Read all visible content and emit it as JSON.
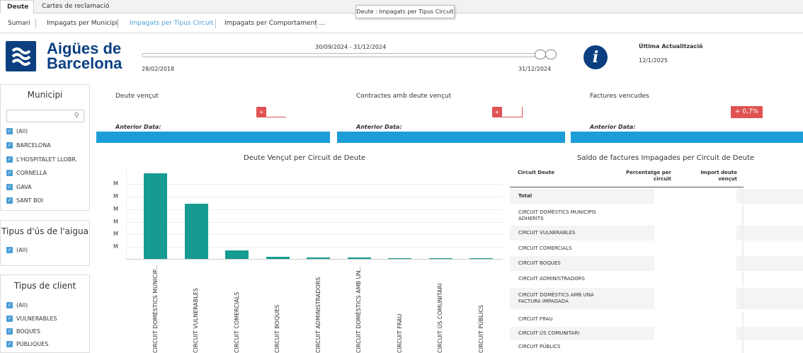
{
  "tabs": [
    "Deute",
    "Cartes de reclamació"
  ],
  "tooltip": "Deute : Impagats per Tipus Circuit",
  "subnav": [
    "Sumari",
    "Impagats per Municipi",
    "Impagats per Tipus Circuit",
    "Impagats per Comportament ..."
  ],
  "logo": {
    "line1": "Aigües de",
    "line2": "Barcelona"
  },
  "date_range": {
    "label": "30/09/2024 - 31/12/2024",
    "min": "28/02/2018",
    "max": "31/12/2024"
  },
  "last_update": {
    "title": "Última Actualització",
    "value": "12/1/2025"
  },
  "filters": {
    "municipi": {
      "title": "Municipi",
      "search_placeholder": "",
      "items": [
        "(All)",
        "BARCELONA",
        "L'HOSPITALET LLOBR.",
        "CORNELLA",
        "GAVA",
        "SANT BOI"
      ]
    },
    "tipus_us": {
      "title": "Tipus d'ús de l'aigua",
      "items": [
        "(All)"
      ]
    },
    "tipus_client": {
      "title": "Tipus de client",
      "items": [
        "(All)",
        "VULNERABLES",
        "BOQUES",
        "PÚBLIQUES"
      ]
    }
  },
  "kpis": [
    {
      "title": "Deute vençut",
      "badge": "+",
      "anterior": "Anterior Data:"
    },
    {
      "title": "Contractes amb deute vençut",
      "badge": "+",
      "anterior": "Anterior Data:"
    },
    {
      "title": "Factures vencudes",
      "badge": "+ 0,7%",
      "anterior": "Anterior Data:"
    }
  ],
  "chart_data": {
    "type": "bar",
    "title": "Deute Vençut per Circuit de Deute",
    "categories": [
      "CIRCUIT DOMÈSTICS MUNICIP...",
      "CIRCUIT VULNERABLES",
      "CIRCUIT COMERCIALS",
      "CIRCUIT BOQUES",
      "CIRCUIT ADMINISTRADORS",
      "CIRCUIT DOMÈSTICS AMB UN..",
      "CIRCUIT FRAU",
      "CIRCUIT ÚS COMUNITARI",
      "CIRCUIT PÚBLICS"
    ],
    "values": [
      6.4,
      4.1,
      0.62,
      0.15,
      0.08,
      0.08,
      0.03,
      0.03,
      0.03
    ],
    "ytick_labels": [
      "M",
      "M",
      "M",
      "M",
      "M",
      "M"
    ],
    "ylim": [
      0,
      6.4
    ],
    "color": "#169b91",
    "grid": true
  },
  "table": {
    "title": "Saldo de factures Impagades per Circuit de Deute",
    "headers": [
      "Circuit Deute",
      "Percentatge per circuit",
      "Import deute vençut"
    ],
    "rows": [
      "Total",
      "CIRCUIT DOMÈSTICS MUNICIPIS ADHERITS",
      "CIRCUIT VULNERABLES",
      "CIRCUIT COMERCIALS",
      "CIRCUIT BOQUES",
      "CIRCUIT ADMINISTRADORS",
      "CIRCUIT DOMÈSTICS AMB UNA FACTURA IMPAGADA",
      "CIRCUIT FRAU",
      "CIRCUIT ÚS COMUNITARI",
      "CIRCUIT PÚBLICS"
    ]
  }
}
